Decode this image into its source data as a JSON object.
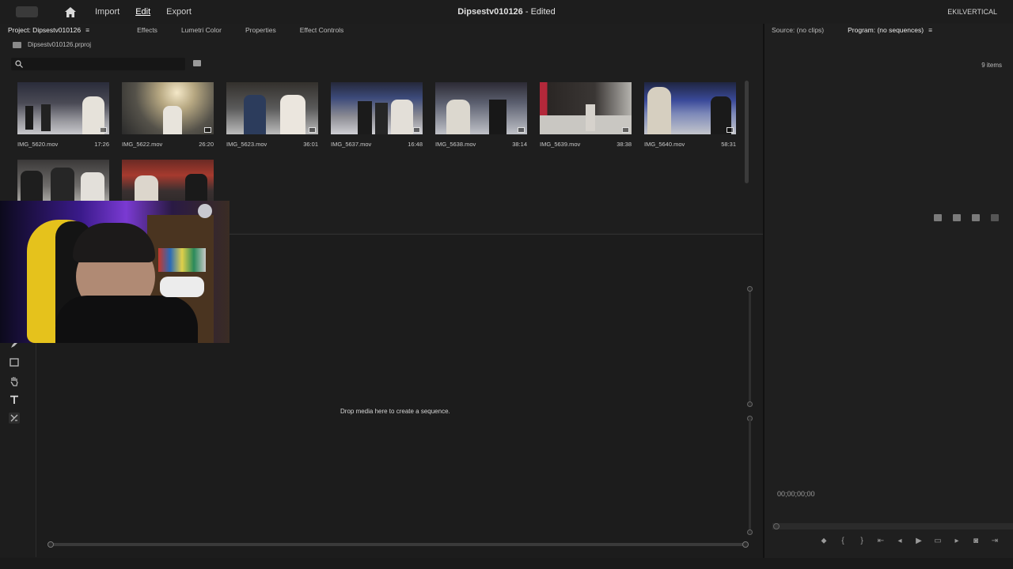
{
  "header": {
    "nav": [
      "Import",
      "Edit",
      "Export"
    ],
    "active_nav": "Edit",
    "doc_name": "Dipsestv010126",
    "doc_status": " - Edited",
    "workspace": "EKILVERTICAL"
  },
  "left_tabs": [
    "Project: Dipsestv010126",
    "Effects",
    "Lumetri Color",
    "Properties",
    "Effect Controls"
  ],
  "right_tabs": [
    "Source: (no clips)",
    "Program: (no sequences)"
  ],
  "project": {
    "file": "Dipsestv010126.prproj",
    "items_count": "9 items",
    "clips": [
      {
        "name": "IMG_5620.mov",
        "duration": "17:26"
      },
      {
        "name": "IMG_5622.mov",
        "duration": "26:20"
      },
      {
        "name": "IMG_5623.mov",
        "duration": "36:01"
      },
      {
        "name": "IMG_5637.mov",
        "duration": "16:48"
      },
      {
        "name": "IMG_5638.mov",
        "duration": "38:14"
      },
      {
        "name": "IMG_5639.mov",
        "duration": "38:38"
      },
      {
        "name": "IMG_5640.mov",
        "duration": "58:31"
      },
      {
        "name": "",
        "duration": ""
      },
      {
        "name": "",
        "duration": ""
      }
    ]
  },
  "timeline": {
    "drop_hint": "Drop media here to create a sequence."
  },
  "program": {
    "timecode": "00;00;00;00"
  },
  "colors": {
    "panel_bg": "#1e1e1e",
    "app_bg": "#232323",
    "text": "#d8d8d8"
  }
}
